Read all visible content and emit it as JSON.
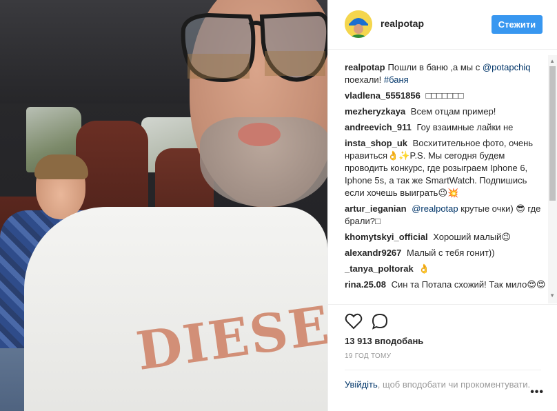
{
  "post": {
    "username": "realpotap",
    "follow_label": "Стежити",
    "caption_user": "realpotap",
    "caption_text_1": "Пошли в баню ,а мы с",
    "caption_mention": "@potapchiq",
    "caption_text_2": "поехали!",
    "caption_hashtag": "#баня",
    "photo_print": "DIESEL"
  },
  "comments": [
    {
      "user": "vladlena_5551856",
      "text": "□□□□□□□"
    },
    {
      "user": "mezheryzkaya",
      "text": "Всем отцам пример!"
    },
    {
      "user": "andreevich_911",
      "text": "Гоу взаимные лайки не"
    },
    {
      "user": "insta_shop_uk",
      "text": "Восхитительное фото, очень нравиться👌✨P.S. Мы сегодня будем проводить конкурс, где розыграем Iphone 6, Iphone 5s, а так же SmartWatch. Подпишись если хочешь выиграть😉💥"
    },
    {
      "user": "artur_ieganian",
      "mention": "@realpotap",
      "text": "крутые очки) 😎 где брали?□"
    },
    {
      "user": "khomytskyi_official",
      "text": "Хороший малый😉"
    },
    {
      "user": "alexandr9267",
      "text": "Малый с тебя гонит))"
    },
    {
      "user": "_tanya_poltorak",
      "text": "👌"
    },
    {
      "user": "rina.25.08",
      "text": "Син та Потапа схожий! Так мило😍😍"
    }
  ],
  "actions": {
    "likes": "13 913 вподобань",
    "time_ago": "19 ГОД ТОМУ",
    "login_link": "Увійдіть",
    "login_rest": ", щоб вподобати чи прокоментувати.",
    "more": "•••"
  },
  "colors": {
    "follow_button": "#3897f0",
    "link": "#003569",
    "muted": "#999999"
  },
  "icons": {
    "like": "heart-outline-icon",
    "comment": "speech-bubble-icon",
    "more": "more-dots-icon"
  }
}
